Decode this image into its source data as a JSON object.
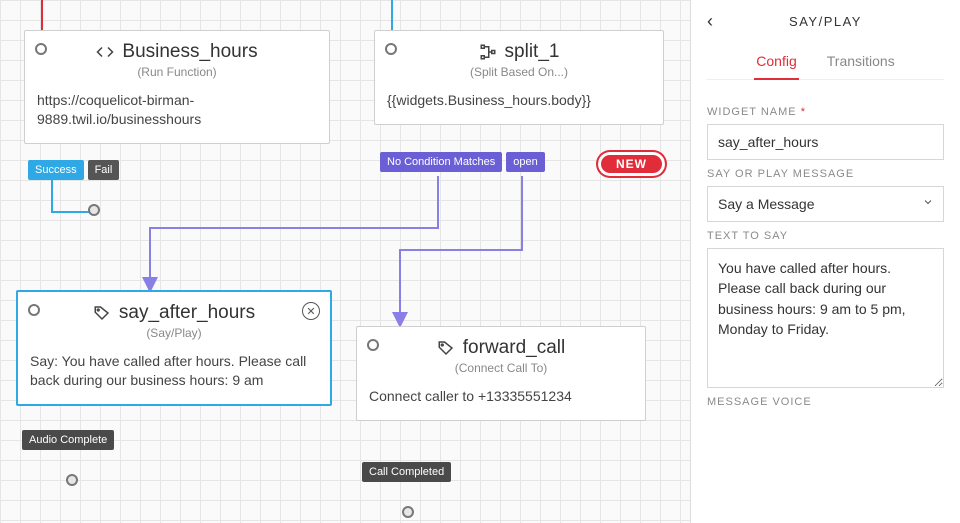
{
  "sidebar": {
    "title": "SAY/PLAY",
    "tabs": {
      "config": "Config",
      "transitions": "Transitions"
    },
    "widget_name_label": "WIDGET NAME",
    "widget_name_value": "say_after_hours",
    "say_or_play_label": "SAY OR PLAY MESSAGE",
    "say_or_play_value": "Say a Message",
    "text_to_say_label": "TEXT TO SAY",
    "text_to_say_value": "You have called after hours. Please call back during our business hours: 9 am to 5 pm, Monday to Friday.",
    "message_voice_label": "MESSAGE VOICE"
  },
  "widgets": {
    "business_hours": {
      "title": "Business_hours",
      "subtitle": "(Run Function)",
      "body": "https://coquelicot-birman-9889.twil.io/businesshours",
      "out_success": "Success",
      "out_fail": "Fail"
    },
    "split1": {
      "title": "split_1",
      "subtitle": "(Split Based On...)",
      "body": "{{widgets.Business_hours.body}}",
      "out_nomatch": "No Condition Matches",
      "out_open": "open",
      "new_label": "NEW"
    },
    "say_after_hours": {
      "title": "say_after_hours",
      "subtitle": "(Say/Play)",
      "body": "Say: You have called after hours. Please call back during our business hours: 9 am",
      "out_audio": "Audio Complete"
    },
    "forward_call": {
      "title": "forward_call",
      "subtitle": "(Connect Call To)",
      "body": "Connect caller to +13335551234",
      "out_completed": "Call Completed"
    }
  }
}
